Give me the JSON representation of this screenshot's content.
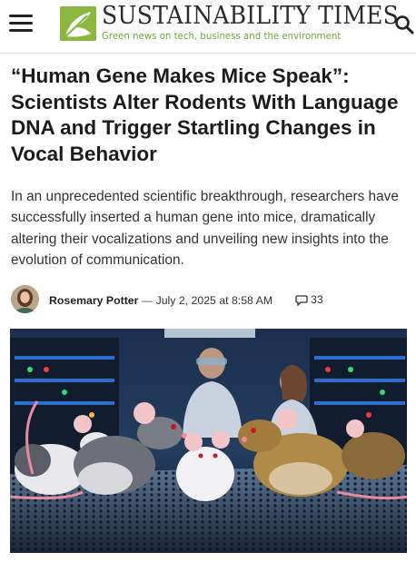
{
  "header": {
    "brand_name": "SUSTAINABILITY TIMES",
    "tagline": "Green news on tech, business and the environment",
    "menu_icon": "hamburger-menu-icon",
    "search_icon": "search-icon",
    "logo_icon": "leaf-logo-icon"
  },
  "article": {
    "title": "“Human Gene Makes Mice Speak”: Scientists Alter Rodents With Language DNA and Trigger Startling Changes in Vocal Behavior",
    "dek": "In an unprecedented scientific breakthrough, researchers have successfully inserted a human gene into mice, dramatically altering their vocalizations and unveiling new insights into the evolution of communication.",
    "author": "Rosemary Potter",
    "separator": "—",
    "date": "July 2, 2025 at 8:58 AM",
    "comment_count": "33",
    "comment_icon": "speech-bubble-icon"
  },
  "colors": {
    "brand_green": "#79a23a",
    "logo_green": "#8ab83f",
    "text_dark": "#1c1c1c"
  }
}
